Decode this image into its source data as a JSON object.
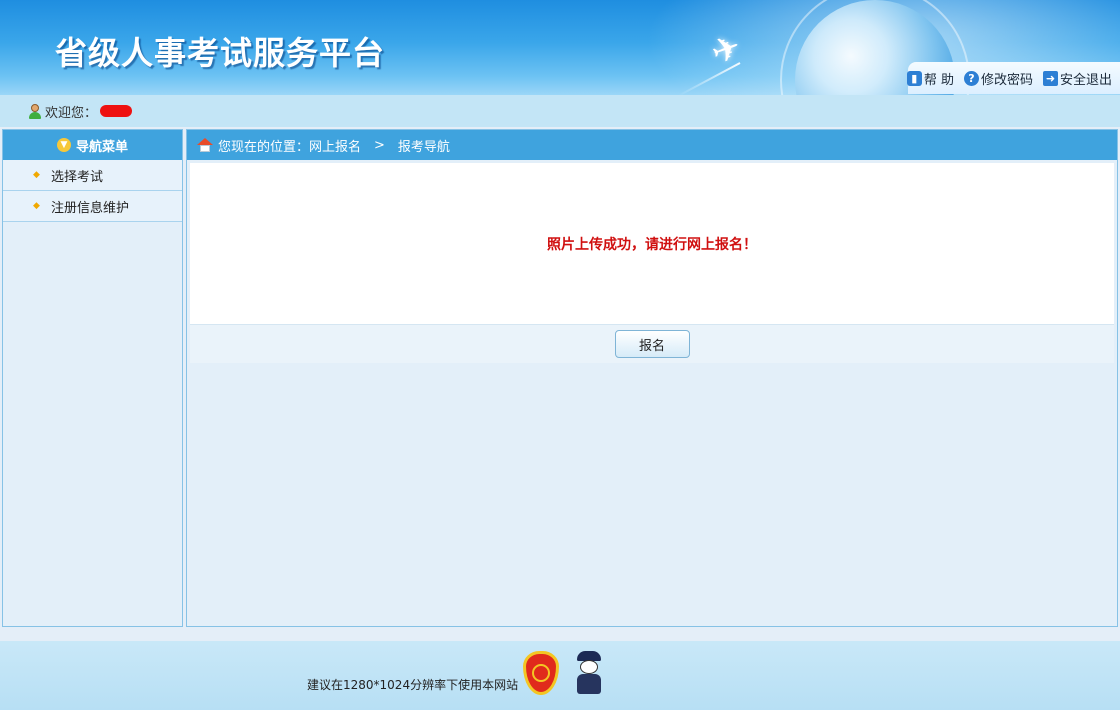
{
  "header": {
    "site_title": "省级人事考试服务平台",
    "tools": {
      "help": "帮 助",
      "change_password": "修改密码",
      "logout": "安全退出"
    }
  },
  "welcome": {
    "label": "欢迎您："
  },
  "sidebar": {
    "title": "导航菜单",
    "items": [
      {
        "label": "选择考试"
      },
      {
        "label": "注册信息维护"
      }
    ]
  },
  "main": {
    "breadcrumb": {
      "prefix": "您现在的位置：网上报名",
      "separator": ">",
      "current": "报考导航"
    },
    "message": "照片上传成功，请进行网上报名！",
    "register_button": "报名"
  },
  "footer": {
    "note": "建议在1280*1024分辨率下使用本网站"
  },
  "colors": {
    "header_blue": "#2c9ae6",
    "panel_head": "#3fa3de",
    "message_red": "#d01010",
    "welcome_bar": "#c3e5f6"
  }
}
